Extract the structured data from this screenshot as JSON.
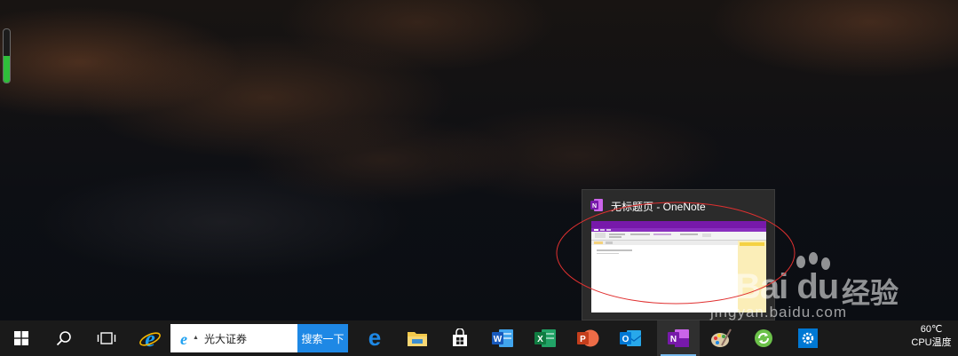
{
  "desktop": {
    "gauge_level": 0.5
  },
  "watermark": {
    "logo_text": "Bai du",
    "logo_cn": "经验",
    "url": "jingyan.baidu.com"
  },
  "preview": {
    "title": "无标题页 - OneNote",
    "icon": "onenote-icon"
  },
  "taskbar": {
    "search": {
      "text": "光大证券",
      "button": "搜索一下",
      "icon": "ie-icon"
    },
    "apps": [
      {
        "name": "start",
        "icon": "windows-logo-icon"
      },
      {
        "name": "search",
        "icon": "search-icon"
      },
      {
        "name": "task-view",
        "icon": "task-view-icon"
      },
      {
        "name": "internet-explorer",
        "icon": "ie-icon"
      },
      {
        "name": "edge",
        "icon": "edge-icon"
      },
      {
        "name": "file-explorer",
        "icon": "folder-icon"
      },
      {
        "name": "store",
        "icon": "store-icon"
      },
      {
        "name": "word",
        "icon": "word-icon"
      },
      {
        "name": "excel",
        "icon": "excel-icon"
      },
      {
        "name": "powerpoint",
        "icon": "powerpoint-icon"
      },
      {
        "name": "outlook",
        "icon": "outlook-icon"
      },
      {
        "name": "onenote",
        "icon": "onenote-icon",
        "active": true
      },
      {
        "name": "paint",
        "icon": "paint-icon"
      },
      {
        "name": "refresh-app",
        "icon": "green-refresh-icon"
      },
      {
        "name": "settings",
        "icon": "gear-icon"
      }
    ],
    "temperature": "60℃",
    "temperature_label": "CPU温度"
  },
  "colors": {
    "taskbar_bg": "#1a1a1a",
    "accent": "#76b9ed",
    "onenote_purple": "#7719aa",
    "search_button": "#1e88e5",
    "highlight_ellipse": "#e03030"
  }
}
